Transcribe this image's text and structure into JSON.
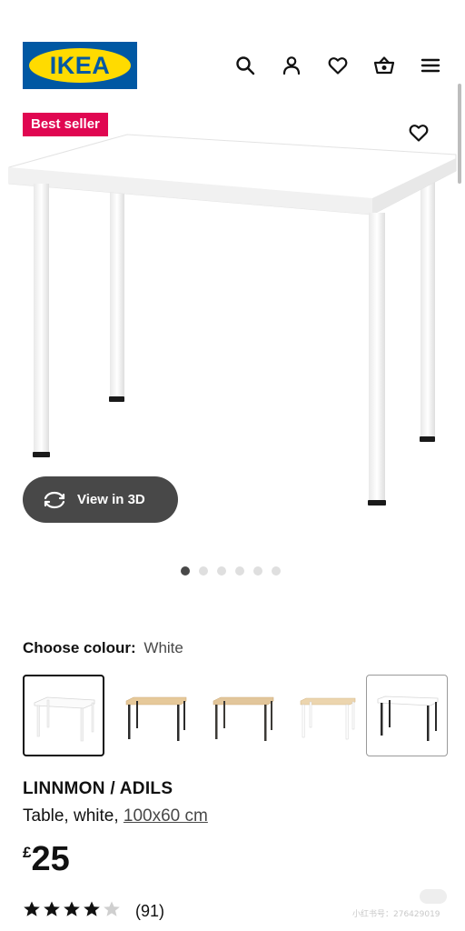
{
  "header": {
    "logo_text": "IKEA",
    "icons": [
      "search-icon",
      "account-icon",
      "heart-icon",
      "basket-icon",
      "menu-icon"
    ]
  },
  "image": {
    "badge": "Best seller",
    "view3d_label": "View in 3D",
    "carousel": {
      "total": 6,
      "current": 1
    }
  },
  "colour": {
    "label": "Choose colour:",
    "value": "White",
    "options": [
      {
        "name": "white-white",
        "top": "#ffffff",
        "legs": "#ffffff",
        "selected": true
      },
      {
        "name": "oak-black",
        "top": "#e6c99a",
        "legs": "#2b2b2b",
        "selected": false
      },
      {
        "name": "oak-dark",
        "top": "#e2c69b",
        "legs": "#3c3a36",
        "selected": false
      },
      {
        "name": "oak-white",
        "top": "#ecd5ae",
        "legs": "#ffffff",
        "selected": false
      },
      {
        "name": "white-black",
        "top": "#ffffff",
        "legs": "#2b2b2b",
        "selected": false
      }
    ]
  },
  "product": {
    "name": "LINNMON / ADILS",
    "desc": "Table, white,",
    "size": "100x60 cm",
    "currency": "£",
    "price": "25",
    "rating": 4.5,
    "rating_count": "(91)"
  },
  "watermark": "小红书号：276429019",
  "colors": {
    "ikea_blue": "#0058a3",
    "ikea_yellow": "#ffdb00",
    "badge_red": "#e00751",
    "pill_gray": "#484848"
  }
}
